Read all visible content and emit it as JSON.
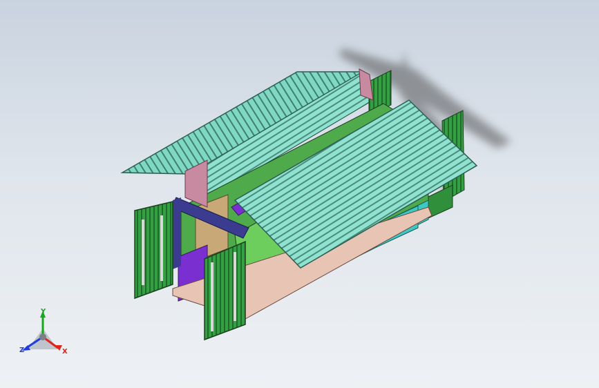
{
  "viewport": {
    "background_top": "#c9d3df",
    "background_bottom": "#eef1f4"
  },
  "model": {
    "roof_color": "#7fd8c4",
    "roof_dark": "#4a8a7a",
    "door_color": "#2f8f3a",
    "frame_color": "#3b3b8f",
    "trim_purple": "#7a2fd0",
    "tank_color": "#3cc9c4"
  },
  "triad": {
    "y_label": "Y",
    "z_label": "Z",
    "x_label": "X",
    "y_color": "#18a81e",
    "z_color": "#1f3dd8",
    "x_color": "#e0241a"
  }
}
